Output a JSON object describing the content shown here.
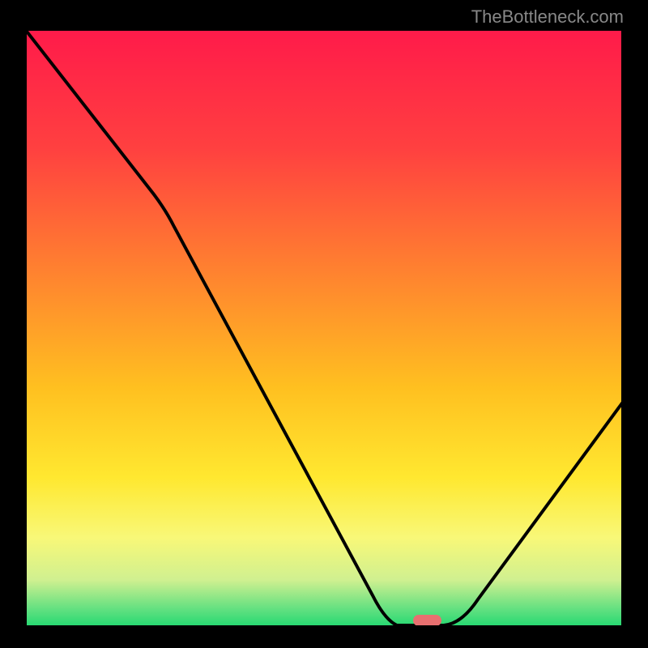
{
  "watermark": "TheBottleneck.com",
  "chart_data": {
    "type": "line",
    "title": "",
    "xlabel": "",
    "ylabel": "",
    "x_range": [
      0,
      100
    ],
    "y_range": [
      0,
      100
    ],
    "curve_points": [
      {
        "x": 0,
        "y": 100
      },
      {
        "x": 22,
        "y": 72
      },
      {
        "x": 58,
        "y": 5
      },
      {
        "x": 62,
        "y": 0
      },
      {
        "x": 70,
        "y": 0
      },
      {
        "x": 75,
        "y": 4
      },
      {
        "x": 100,
        "y": 38
      }
    ],
    "marker": {
      "x": 67,
      "y": 0
    },
    "gradient_stops": [
      {
        "offset": 0,
        "color": "#ff1a4a"
      },
      {
        "offset": 20,
        "color": "#ff4040"
      },
      {
        "offset": 40,
        "color": "#ff8030"
      },
      {
        "offset": 60,
        "color": "#ffc020"
      },
      {
        "offset": 75,
        "color": "#ffe830"
      },
      {
        "offset": 85,
        "color": "#f8f878"
      },
      {
        "offset": 92,
        "color": "#d0f090"
      },
      {
        "offset": 97,
        "color": "#60e080"
      },
      {
        "offset": 100,
        "color": "#20d870"
      }
    ]
  }
}
